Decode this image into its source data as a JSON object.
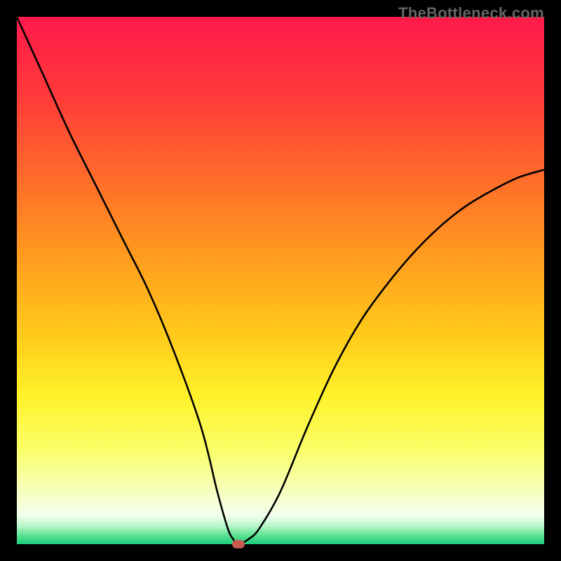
{
  "watermark": "TheBottleneck.com",
  "colors": {
    "frame": "#000000",
    "watermark_text": "#646464",
    "curve": "#000000",
    "marker": "#c95a50",
    "gradient_stops": [
      {
        "offset": 0.0,
        "color": "#ff1a4b"
      },
      {
        "offset": 0.15,
        "color": "#ff3a3a"
      },
      {
        "offset": 0.3,
        "color": "#ff6a2a"
      },
      {
        "offset": 0.45,
        "color": "#ff9a1f"
      },
      {
        "offset": 0.6,
        "color": "#ffc91a"
      },
      {
        "offset": 0.72,
        "color": "#fff22a"
      },
      {
        "offset": 0.82,
        "color": "#fbff68"
      },
      {
        "offset": 0.9,
        "color": "#f7ffbe"
      },
      {
        "offset": 0.945,
        "color": "#f3ffee"
      },
      {
        "offset": 0.965,
        "color": "#b9f7c9"
      },
      {
        "offset": 0.985,
        "color": "#55e08e"
      },
      {
        "offset": 1.0,
        "color": "#19cc7a"
      }
    ]
  },
  "chart_data": {
    "type": "line",
    "title": "",
    "xlabel": "",
    "ylabel": "",
    "xlim": [
      0,
      100
    ],
    "ylim": [
      0,
      100
    ],
    "grid": false,
    "series": [
      {
        "name": "bottleneck-curve",
        "x": [
          0,
          5,
          10,
          15,
          20,
          25,
          30,
          35,
          38,
          40,
          41,
          42,
          44,
          46,
          50,
          55,
          60,
          65,
          70,
          75,
          80,
          85,
          90,
          95,
          100
        ],
        "values": [
          100,
          89,
          78,
          68,
          58,
          48,
          36,
          22,
          10,
          3,
          1,
          0,
          1,
          3,
          10,
          22,
          33,
          42,
          49,
          55,
          60,
          64,
          67,
          69.5,
          71
        ]
      }
    ],
    "marker": {
      "name": "current-point",
      "x": 42,
      "y": 0,
      "color": "#c95a50"
    }
  }
}
